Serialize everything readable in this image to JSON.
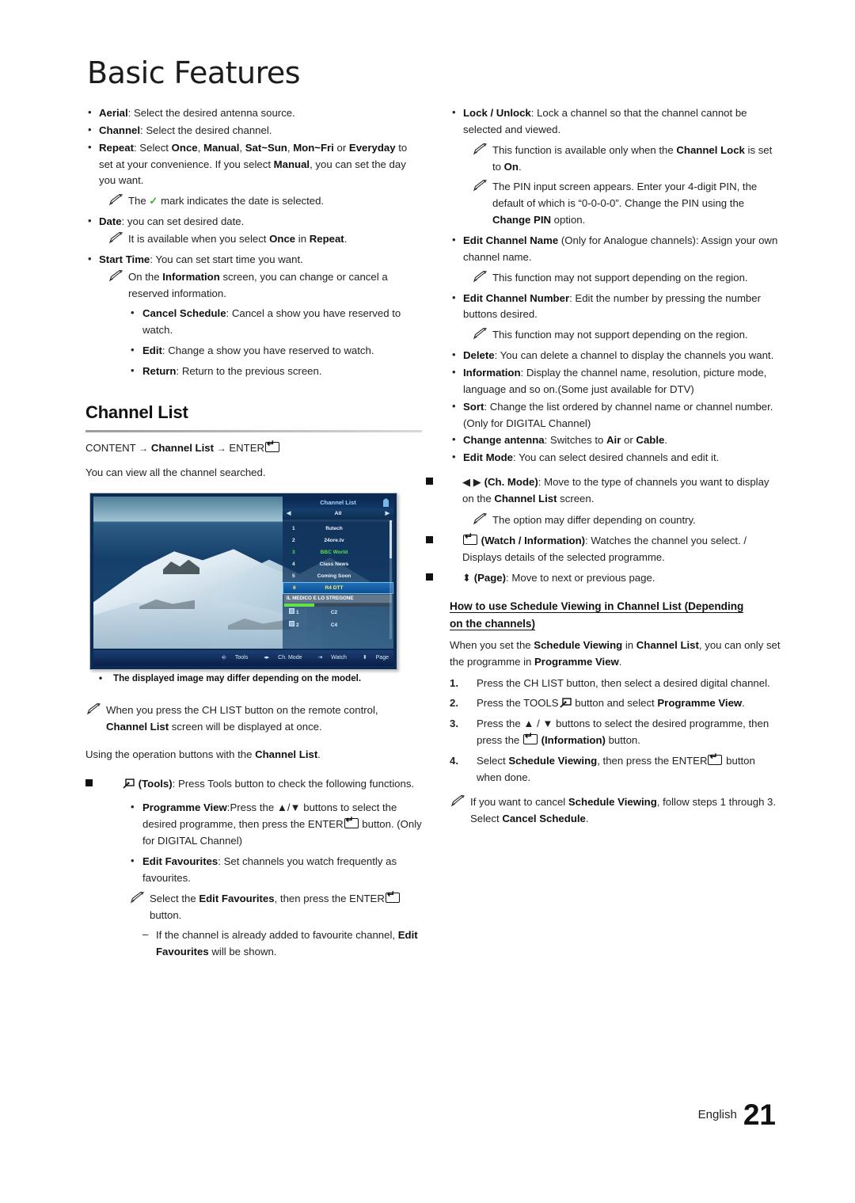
{
  "page": {
    "title": "Basic Features",
    "footer_language": "English",
    "footer_page_number": "21"
  },
  "left_column": {
    "bullets_top": [
      {
        "term": "Aerial",
        "rest": ": Select the desired antenna source."
      },
      {
        "term": "Channel",
        "rest": ": Select the desired channel."
      }
    ],
    "repeat_item": {
      "term": "Repeat",
      "text_parts": [
        ": Select ",
        "Once",
        ", ",
        "Manual",
        ", ",
        "Sat~Sun",
        ", ",
        "Mon~Fri",
        " or ",
        "Everyday",
        " to set at your convenience. If you select ",
        "Manual",
        ", you can set the day you want."
      ]
    },
    "note_check": "The ✔ mark indicates the date is selected.",
    "note_check_pre": "The",
    "note_check_post": "mark indicates the date is selected.",
    "date_item": {
      "term": "Date",
      "rest": ": you can set desired date."
    },
    "note_once": "It is available when you select Once in Repeat.",
    "start_time_item": {
      "term": "Start Time",
      "rest": ": You can set start time you want."
    },
    "note_information": "On the Information screen, you can change or cancel a reserved information.",
    "sub_bullets": [
      {
        "term": "Cancel Schedule",
        "rest": ": Cancel a show you have reserved to watch."
      },
      {
        "term": "Edit",
        "rest": ": Change a show you have reserved to watch."
      },
      {
        "term": "Return",
        "rest": ": Return to the previous screen."
      }
    ],
    "section_heading": "Channel List",
    "content_path": {
      "prefix": "CONTENT",
      "arrow": "→",
      "middle": "Channel List",
      "suffix": "ENTER"
    },
    "lead": "You can view all the channel searched.",
    "image_caption": "The displayed image may differ depending on the model.",
    "note_chlist": {
      "pre": "When you press the ",
      "key": "CH LIST",
      "mid": " button on the remote control, ",
      "bold2": "Channel List",
      "post": " screen will be displayed at once."
    },
    "using_line": {
      "pre": "Using the operation buttons with the ",
      "bold": "Channel List",
      "post": "."
    },
    "tools_item": {
      "bold": "(Tools)",
      "rest": ": Press Tools button to check the following functions."
    },
    "programme_view_item": {
      "term": "Programme View",
      "p1": ":Press the ▲/▼ buttons to select the desired programme, then press the ENTER",
      "p2": " button. (Only for DIGITAL Channel)"
    },
    "edit_favourites_item": {
      "term": "Edit Favourites",
      "rest": ": Set channels you watch frequently as favourites."
    },
    "note_fav": {
      "pre": "Select the  ",
      "bold": "Edit Favourites",
      "mid": ", then press the ENTER",
      "post": " button."
    },
    "dash_fav": {
      "pre": "If the channel is already added to favourite channel, ",
      "bold": "Edit Favourites",
      "post": " will be shown."
    }
  },
  "tv_screen": {
    "panel_title": "Channel List",
    "filter": "All",
    "left_arrow": "◀",
    "right_arrow": "▶",
    "rows": [
      {
        "num": "1",
        "name": "flutech",
        "state": "normal"
      },
      {
        "num": "2",
        "name": "24ore.tv",
        "state": "normal"
      },
      {
        "num": "3",
        "name": "BBC World",
        "state": "current"
      },
      {
        "num": "4",
        "name": "Class News",
        "state": "normal"
      },
      {
        "num": "5",
        "name": "Coming Soon",
        "state": "normal"
      },
      {
        "num": "6",
        "name": "R4 DTT",
        "state": "selected"
      }
    ],
    "programme": "IL MEDICO E LO STREGONE",
    "progress_percent": 28,
    "fav_rows": [
      {
        "num": "1",
        "name": "C2"
      },
      {
        "num": "2",
        "name": "C4"
      }
    ],
    "bottom_bar": [
      {
        "icon": "tools-icon",
        "label": "Tools"
      },
      {
        "icon": "left-right-icon",
        "label": "Ch. Mode"
      },
      {
        "icon": "enter-icon",
        "label": "Watch"
      },
      {
        "icon": "updown-icon",
        "label": "Page"
      }
    ],
    "colors": {
      "current_channel": "#54e04a",
      "selected_channel_text": "#ffe96a",
      "progress_bar": "#63e24a",
      "panel_title": "#a9d8ff"
    }
  },
  "right_column": {
    "lock_item": {
      "term": "Lock / Unlock",
      "rest": ": Lock a channel so that the channel cannot be selected and viewed."
    },
    "note_lock": {
      "pre": "This function is available only when the ",
      "b1": "Channel Lock",
      "mid": " is set to ",
      "b2": "On",
      "post": "."
    },
    "note_pin": {
      "pre": "The PIN input screen appears. Enter your 4-digit PIN, the default of which is “0-0-0-0”. Change the PIN using the ",
      "bold": "Change PIN",
      "post": " option."
    },
    "edit_name_item": {
      "term": "Edit Channel Name",
      "paren": " (Only for Analogue channels)",
      "rest": ": Assign your own channel name."
    },
    "note_region_1": "This function may not support depending on the region.",
    "edit_number_item": {
      "term": "Edit Channel Number",
      "rest": ": Edit the number by pressing the number buttons desired."
    },
    "note_region_2": "This function may not support depending on the region.",
    "bullets": [
      {
        "term": "Delete",
        "rest": ": You can delete a channel to display the channels you want."
      },
      {
        "term": "Information",
        "rest": ": Display the channel name, resolution, picture mode, language and so on.(Some just available for DTV)"
      },
      {
        "term": "Sort",
        "rest": ": Change the list ordered by channel name or channel number. (Only for DIGITAL Channel)"
      }
    ],
    "change_antenna": {
      "term": "Change antenna",
      "pre": ": Switches to ",
      "b1": "Air",
      "mid": " or ",
      "b2": "Cable",
      "post": "."
    },
    "edit_mode": {
      "term": "Edit Mode",
      "rest": ": You can select desired channels and edit it."
    },
    "ch_mode_item": {
      "glyph": "◀ ▶",
      "bold": "(Ch. Mode)",
      "pre": ": Move to the type of channels you want to display on the ",
      "boldmid": "Channel List",
      "post": " screen."
    },
    "note_country": "The option may differ depending on country.",
    "watch_item": {
      "bold": "(Watch / Information)",
      "rest": ": Watches the channel you select. / Displays details of the selected programme."
    },
    "page_item": {
      "glyph": "⬍",
      "bold": "(Page)",
      "rest": ": Move to next or previous page."
    },
    "schedule_heading_line1": "How to use Schedule Viewing in Channel List (Depending",
    "schedule_heading_line2": "on the channels)",
    "schedule_intro": {
      "pre": "When you set the ",
      "b1": "Schedule Viewing",
      "mid": " in ",
      "b2": "Channel List",
      "mid2": ", you can only set the programme in ",
      "b3": "Programme View",
      "post": "."
    },
    "steps": [
      {
        "n": "1.",
        "pre": "Press the ",
        "key": "CH LIST",
        "post": " button, then select a desired digital channel."
      },
      {
        "n": "2.",
        "pre": "Press the ",
        "key": "TOOLS",
        "mid": " button and select ",
        "bold": "Programme View",
        "post": "."
      },
      {
        "n": "3.",
        "pre": "Press the ▲ / ▼ buttons to select the desired programme, then press the ",
        "bold": "(Information)",
        "post": " button."
      },
      {
        "n": "4.",
        "pre": "Select ",
        "bold": "Schedule Viewing",
        "mid": ", then press the ENTER",
        "post": " button when done."
      }
    ],
    "note_cancel": {
      "pre": "If you want to cancel ",
      "b1": "Schedule Viewing",
      "mid": ", follow steps 1 through 3. Select ",
      "b2": "Cancel Schedule",
      "post": "."
    }
  }
}
